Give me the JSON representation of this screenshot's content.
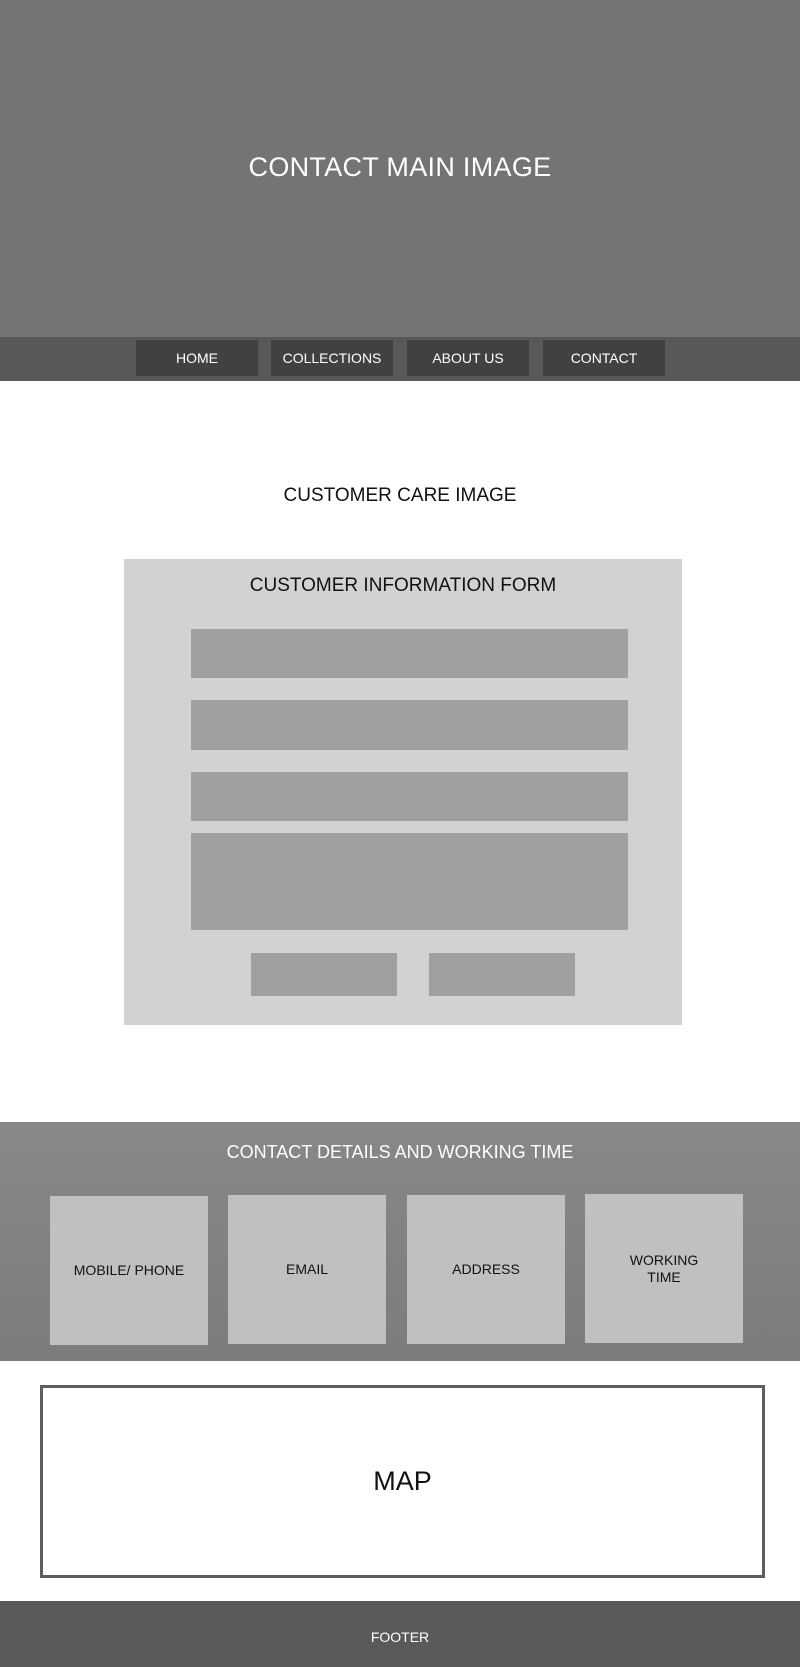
{
  "hero": {
    "title": "CONTACT MAIN IMAGE"
  },
  "nav": {
    "items": [
      {
        "label": "HOME"
      },
      {
        "label": "COLLECTIONS"
      },
      {
        "label": "ABOUT US"
      },
      {
        "label": "CONTACT"
      }
    ]
  },
  "customer_care": {
    "label": "CUSTOMER CARE IMAGE"
  },
  "form": {
    "title": "CUSTOMER INFORMATION FORM"
  },
  "contact_details": {
    "title": "CONTACT DETAILS AND WORKING TIME",
    "cards": [
      {
        "label": "MOBILE/ PHONE"
      },
      {
        "label": "EMAIL"
      },
      {
        "label": "ADDRESS"
      },
      {
        "label": "WORKING\nTIME"
      }
    ]
  },
  "map": {
    "label": "MAP"
  },
  "footer": {
    "label": "FOOTER"
  },
  "colors": {
    "hero_bg": "#747474",
    "nav_bg": "#585858",
    "nav_button": "#414141",
    "form_panel": "#d2d2d2",
    "form_field": "#a0a0a0",
    "contact_bg": "#808080",
    "card_bg": "#c0c0c0",
    "footer_bg": "#5a5a5a"
  }
}
